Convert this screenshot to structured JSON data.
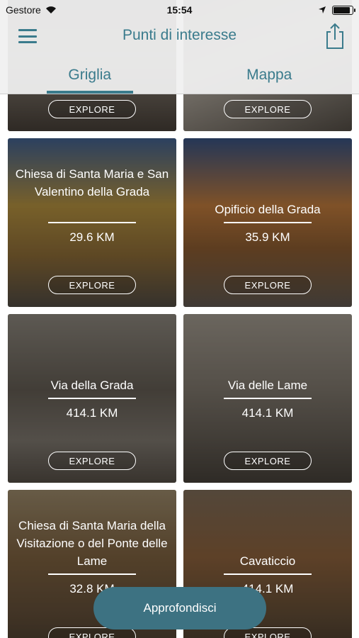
{
  "status": {
    "carrier": "Gestore",
    "time": "15:54",
    "battery_level": 0.9
  },
  "header": {
    "title": "Punti di interesse",
    "tabs": [
      {
        "label": "Griglia",
        "active": true
      },
      {
        "label": "Mappa",
        "active": false
      }
    ]
  },
  "colors": {
    "accent": "#3a7b8c",
    "fab": "#3d7282"
  },
  "cards": [
    {
      "title": "",
      "distance": "",
      "explore": "EXPLORE"
    },
    {
      "title": "",
      "distance": "",
      "explore": "EXPLORE"
    },
    {
      "title": "Chiesa di Santa Maria e San Valentino della Grada",
      "distance": "29.6 KM",
      "explore": "EXPLORE"
    },
    {
      "title": "Opificio della Grada",
      "distance": "35.9 KM",
      "explore": "EXPLORE"
    },
    {
      "title": "Via della Grada",
      "distance": "414.1 KM",
      "explore": "EXPLORE"
    },
    {
      "title": "Via delle Lame",
      "distance": "414.1 KM",
      "explore": "EXPLORE"
    },
    {
      "title": "Chiesa di Santa Maria della Visitazione o del Ponte delle Lame",
      "distance": "32.8 KM",
      "explore": "EXPLORE"
    },
    {
      "title": "Cavaticcio",
      "distance": "414.1 KM",
      "explore": "EXPLORE"
    }
  ],
  "fab": {
    "label": "Approfondisci"
  }
}
